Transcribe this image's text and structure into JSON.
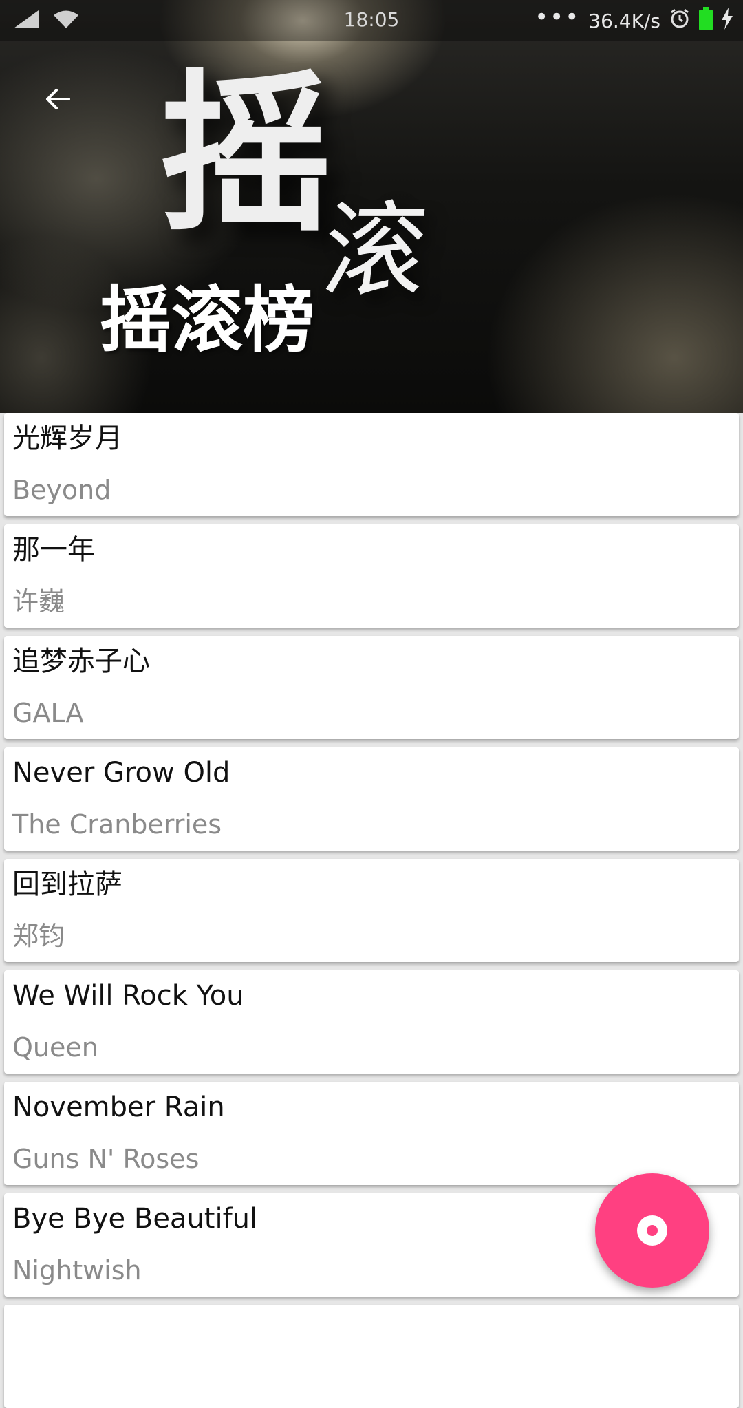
{
  "status_bar": {
    "time": "18:05",
    "net_speed": "36.4K/s",
    "icons": [
      "signal-icon",
      "wifi-icon",
      "more-dots-icon",
      "alarm-icon",
      "battery-icon",
      "charging-icon"
    ]
  },
  "header": {
    "back_icon": "arrow-back-icon",
    "hero_big_char_1": "摇",
    "hero_big_char_2": "滚",
    "title": "摇滚榜"
  },
  "songs": [
    {
      "title": "光辉岁月",
      "artist": "Beyond"
    },
    {
      "title": "那一年",
      "artist": "许巍"
    },
    {
      "title": "追梦赤子心",
      "artist": "GALA"
    },
    {
      "title": "Never Grow Old",
      "artist": "The Cranberries"
    },
    {
      "title": "回到拉萨",
      "artist": "郑钧"
    },
    {
      "title": "We Will Rock You",
      "artist": "Queen"
    },
    {
      "title": "November Rain",
      "artist": "Guns N' Roses"
    },
    {
      "title": "Bye Bye Beautiful",
      "artist": "Nightwish"
    }
  ],
  "fab": {
    "icon": "disc-icon",
    "color": "#ff4081"
  },
  "colors": {
    "card_bg": "#ffffff",
    "title_text": "#111111",
    "artist_text": "#8a8a8a",
    "battery": "#22dd22"
  }
}
